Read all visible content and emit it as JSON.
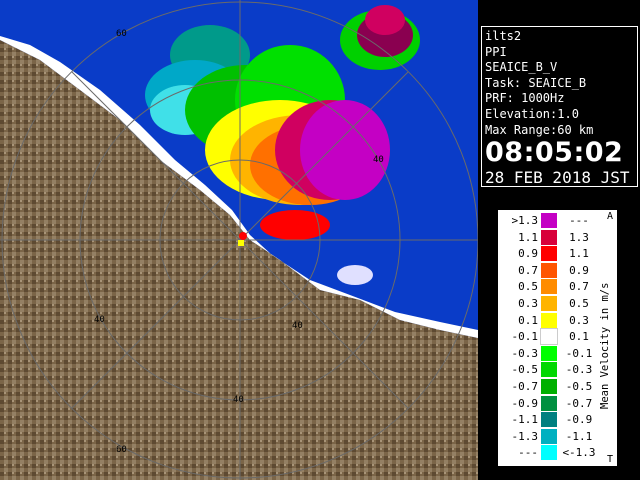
{
  "info": {
    "site": "ilts2",
    "product": "PPI",
    "product_name": "SEAICE_B_V",
    "task": "Task: SEAICE_B",
    "prf": "PRF: 1000Hz",
    "elevation": "Elevation:1.0",
    "max_range": "Max Range:60 km",
    "time": "08:05:02",
    "date": "28 FEB 2018 JST"
  },
  "range_labels": [
    "60",
    "40",
    "40",
    "40",
    "40",
    "60"
  ],
  "legend": {
    "title": "Mean Velocity in m/s",
    "top_mark": "A",
    "bottom_mark": "T",
    "rows": [
      {
        "lo": ">1.3",
        "hi": "---",
        "color": "#c400c4"
      },
      {
        "lo": "1.1",
        "hi": "1.3",
        "color": "#d8003a"
      },
      {
        "lo": "0.9",
        "hi": "1.1",
        "color": "#ff0000"
      },
      {
        "lo": "0.7",
        "hi": "0.9",
        "color": "#ff5500"
      },
      {
        "lo": "0.5",
        "hi": "0.7",
        "color": "#ff8c00"
      },
      {
        "lo": "0.3",
        "hi": "0.5",
        "color": "#ffb400"
      },
      {
        "lo": "0.1",
        "hi": "0.3",
        "color": "#ffff00"
      },
      {
        "lo": "-0.1",
        "hi": "0.1",
        "color": "#ffffff"
      },
      {
        "lo": "-0.3",
        "hi": "-0.1",
        "color": "#00ff00"
      },
      {
        "lo": "-0.5",
        "hi": "-0.3",
        "color": "#00d800"
      },
      {
        "lo": "-0.7",
        "hi": "-0.5",
        "color": "#00b000"
      },
      {
        "lo": "-0.9",
        "hi": "-0.7",
        "color": "#009040"
      },
      {
        "lo": "-1.1",
        "hi": "-0.9",
        "color": "#008080"
      },
      {
        "lo": "-1.3",
        "hi": "-1.1",
        "color": "#00b0c0"
      },
      {
        "lo": "---",
        "hi": "<-1.3",
        "color": "#00ffff"
      }
    ]
  },
  "colors": {
    "sea": "#0a3cc8",
    "land": "#7a6446",
    "ring": "#6a6a6a"
  }
}
